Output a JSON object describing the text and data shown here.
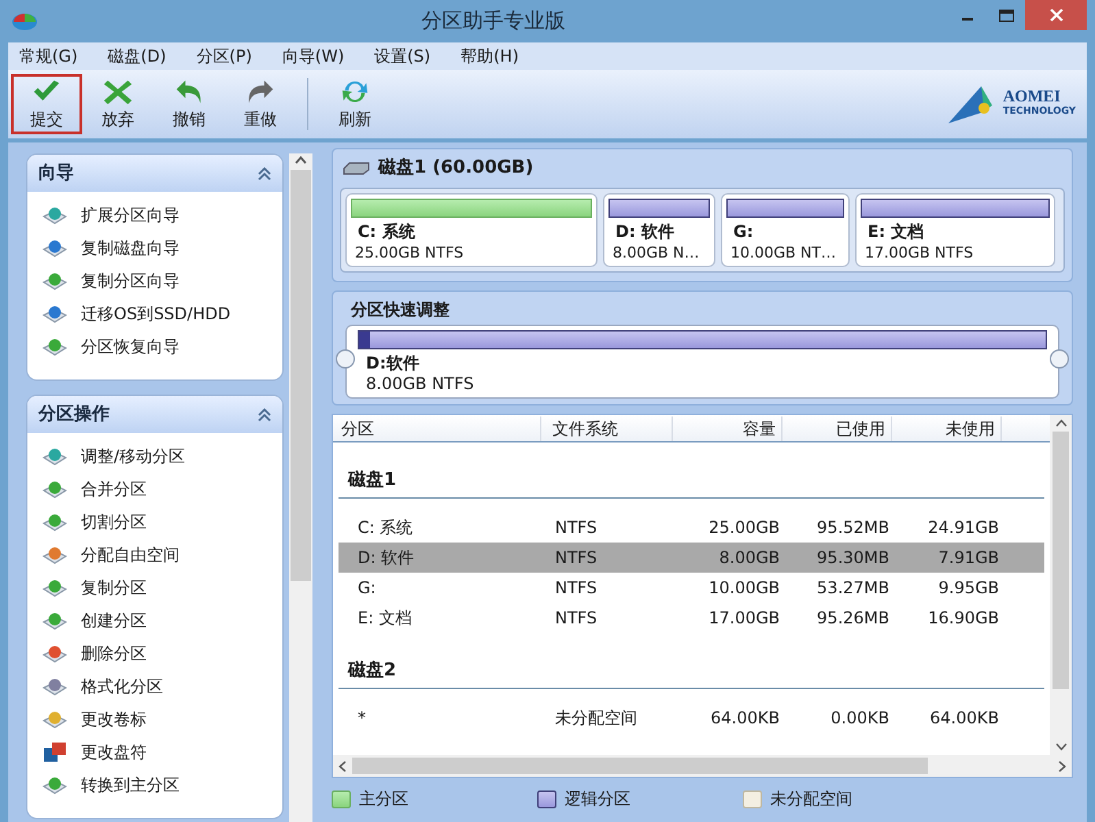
{
  "window": {
    "title": "分区助手专业版"
  },
  "menu": [
    "常规(G)",
    "磁盘(D)",
    "分区(P)",
    "向导(W)",
    "设置(S)",
    "帮助(H)"
  ],
  "toolbar": [
    {
      "label": "提交",
      "kind": "check",
      "selected": true
    },
    {
      "label": "放弃",
      "kind": "cross",
      "selected": false
    },
    {
      "label": "撤销",
      "kind": "undo",
      "selected": false
    },
    {
      "label": "重做",
      "kind": "redo",
      "selected": false
    },
    {
      "label": "刷新",
      "kind": "refresh",
      "selected": false
    }
  ],
  "logo": {
    "name": "AOMEI",
    "tagline": "TECHNOLOGY"
  },
  "sidebar": [
    {
      "title": "向导",
      "expanded": true,
      "items": [
        {
          "label": "扩展分区向导",
          "kind": "extend"
        },
        {
          "label": "复制磁盘向导",
          "kind": "down"
        },
        {
          "label": "复制分区向导",
          "kind": "copy"
        },
        {
          "label": "迁移OS到SSD/HDD",
          "kind": "down"
        },
        {
          "label": "分区恢复向导",
          "kind": "recover"
        }
      ]
    },
    {
      "title": "分区操作",
      "expanded": true,
      "items": [
        {
          "label": "调整/移动分区",
          "kind": "extend"
        },
        {
          "label": "合并分区",
          "kind": "copy"
        },
        {
          "label": "切割分区",
          "kind": "copy"
        },
        {
          "label": "分配自由空间",
          "kind": "alloc"
        },
        {
          "label": "复制分区",
          "kind": "copy"
        },
        {
          "label": "创建分区",
          "kind": "create"
        },
        {
          "label": "删除分区",
          "kind": "delete"
        },
        {
          "label": "格式化分区",
          "kind": "format"
        },
        {
          "label": "更改卷标",
          "kind": "label"
        },
        {
          "label": "更改盘符",
          "kind": "letter"
        },
        {
          "label": "转换到主分区",
          "kind": "recover"
        }
      ]
    }
  ],
  "disk": {
    "title": "磁盘1 (60.00GB)",
    "partitions": [
      {
        "name": "C: 系统",
        "detail": "25.00GB NTFS",
        "kind": "primary"
      },
      {
        "name": "D: 软件",
        "detail": "8.00GB N…",
        "kind": "logical"
      },
      {
        "name": "G:",
        "detail": "10.00GB NT…",
        "kind": "logical"
      },
      {
        "name": "E: 文档",
        "detail": "17.00GB NTFS",
        "kind": "logical"
      }
    ]
  },
  "quick_adjust": {
    "title": "分区快速调整",
    "name": "D:软件",
    "detail": "8.00GB NTFS",
    "level": 0.015
  },
  "table": {
    "columns": [
      "分区",
      "文件系统",
      "容量",
      "已使用",
      "未使用"
    ],
    "groups": [
      {
        "name": "磁盘1",
        "rows": [
          {
            "cells": [
              "C: 系统",
              "NTFS",
              "25.00GB",
              "95.52MB",
              "24.91GB"
            ],
            "selected": false
          },
          {
            "cells": [
              "D: 软件",
              "NTFS",
              "8.00GB",
              "95.30MB",
              "7.91GB"
            ],
            "selected": true
          },
          {
            "cells": [
              "G:",
              "NTFS",
              "10.00GB",
              "53.27MB",
              "9.95GB"
            ],
            "selected": false
          },
          {
            "cells": [
              "E: 文档",
              "NTFS",
              "17.00GB",
              "95.26MB",
              "16.90GB"
            ],
            "selected": false
          }
        ]
      },
      {
        "name": "磁盘2",
        "rows": [
          {
            "cells": [
              "*",
              "未分配空间",
              "64.00KB",
              "0.00KB",
              "64.00KB"
            ],
            "selected": false
          }
        ]
      }
    ]
  },
  "legend": [
    {
      "label": "主分区",
      "kind": "primary"
    },
    {
      "label": "逻辑分区",
      "kind": "logical"
    },
    {
      "label": "未分配空间",
      "kind": "unallocated"
    }
  ]
}
